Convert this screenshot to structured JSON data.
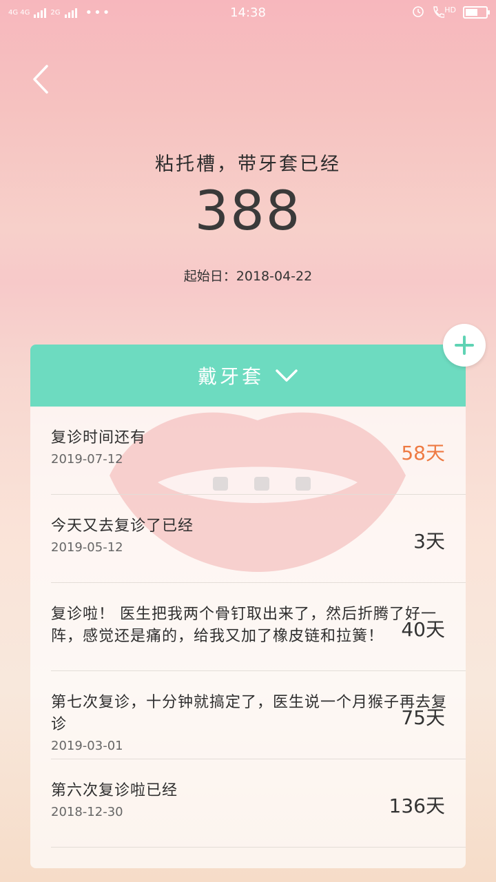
{
  "status_bar": {
    "network_left": "4G 4G",
    "network_right": "2G",
    "time": "14:38",
    "hd": "HD",
    "battery_level": 0.6
  },
  "header": {
    "headline": "粘托槽，带牙套已经",
    "days": "388",
    "start_label": "起始日：",
    "start_date": "2018-04-22"
  },
  "card": {
    "title": "戴牙套",
    "accent_color": "#6ddbc0",
    "items": [
      {
        "title": "复诊时间还有",
        "date": "2019-07-12",
        "days": "58天",
        "highlight": true
      },
      {
        "title": "今天又去复诊了已经",
        "date": "2019-05-12",
        "days": "3天",
        "highlight": false
      },
      {
        "title": "复诊啦！ 医生把我两个骨钉取出来了，然后折腾了好一阵，感觉还是痛的，给我又加了橡皮链和拉簧！",
        "date": "",
        "days": "40天",
        "highlight": false
      },
      {
        "title": "第七次复诊，十分钟就搞定了，医生说一个月猴子再去复诊",
        "date": "2019-03-01",
        "days": "75天",
        "highlight": false
      },
      {
        "title": "第六次复诊啦已经",
        "date": "2018-12-30",
        "days": "136天",
        "highlight": false
      }
    ]
  },
  "colors": {
    "highlight": "#ee7a43",
    "add_icon": "#5fd3b4"
  }
}
